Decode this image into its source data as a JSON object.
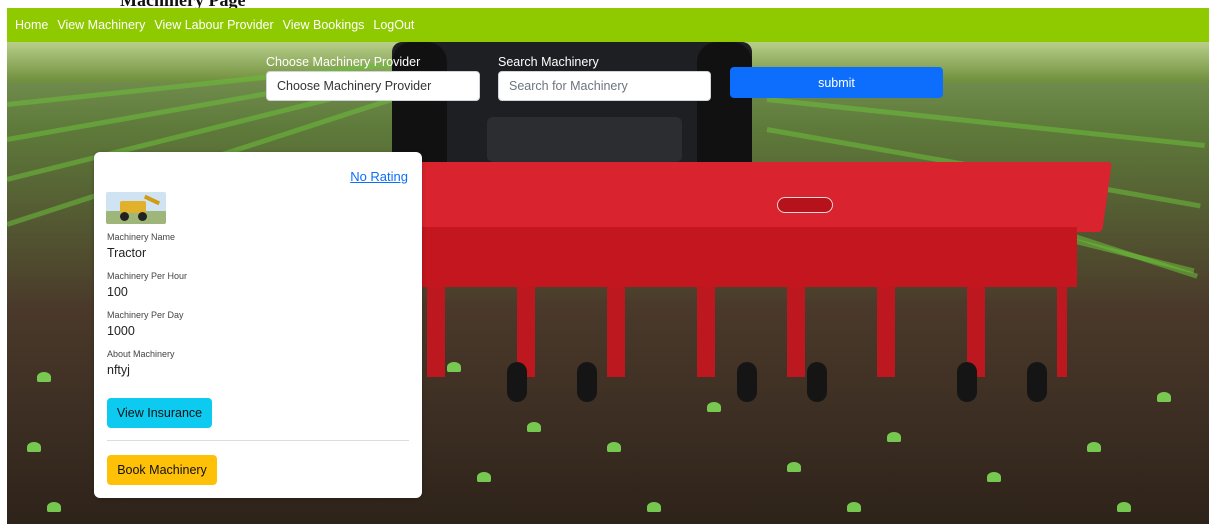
{
  "page": {
    "title_fragment": "Machinery Page"
  },
  "nav": {
    "items": [
      {
        "label": "Home"
      },
      {
        "label": "View Machinery"
      },
      {
        "label": "View Labour Provider"
      },
      {
        "label": "View Bookings"
      },
      {
        "label": "LogOut"
      }
    ],
    "bg_color": "#8fca00"
  },
  "search": {
    "provider_label": "Choose Machinery Provider",
    "provider_value": "Choose Machinery Provider",
    "machinery_label": "Search Machinery",
    "machinery_placeholder": "Search for Machinery",
    "submit_label": "submit"
  },
  "card": {
    "rating": "No Rating",
    "thumbnail_icon": "backhoe-loader-image",
    "fields": [
      {
        "label": "Machinery Name",
        "value": "Tractor"
      },
      {
        "label": "Machinery Per Hour",
        "value": "100"
      },
      {
        "label": "Machinery Per Day",
        "value": "1000"
      },
      {
        "label": "About Machinery",
        "value": "nftyj"
      }
    ],
    "insurance_label": "View Insurance",
    "book_label": "Book Machinery"
  },
  "colors": {
    "submit": "#0d6efd",
    "insurance": "#0dcaf0",
    "book": "#ffc107"
  }
}
